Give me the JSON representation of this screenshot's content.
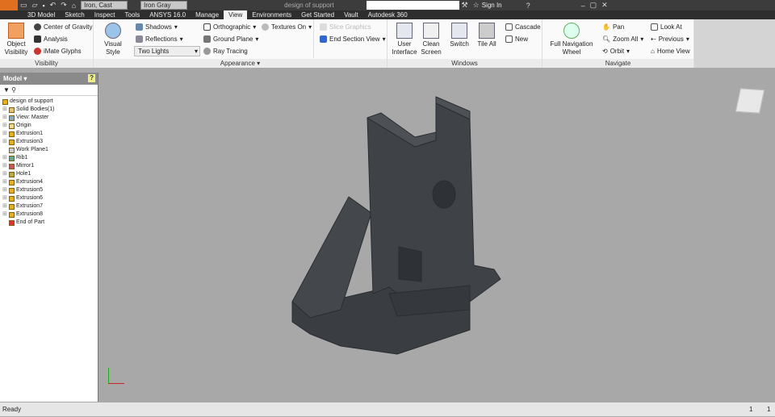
{
  "titlebar": {
    "material": "Iron, Cast",
    "appearance": "Iron Gray",
    "doc_title": "design of support",
    "sign_in": "Sign In"
  },
  "tabs": [
    "3D Model",
    "Sketch",
    "Inspect",
    "Tools",
    "ANSYS 16.0",
    "Manage",
    "View",
    "Environments",
    "Get Started",
    "Vault",
    "Autodesk 360"
  ],
  "ribbon": {
    "visibility": {
      "label": "Visibility",
      "object_visibility": "Object Visibility",
      "center_of_gravity": "Center of Gravity",
      "analysis": "Analysis",
      "imate_glyphs": "iMate Glyphs"
    },
    "appearance": {
      "label": "Appearance",
      "visual_style": "Visual Style",
      "shadows": "Shadows",
      "reflections": "Reflections",
      "lighting": "Two Lights",
      "orthographic": "Orthographic",
      "ground_plane": "Ground Plane",
      "ray_tracing": "Ray Tracing",
      "textures": "Textures On",
      "slice_graphics": "Slice Graphics",
      "end_section_view": "End Section View"
    },
    "windows": {
      "label": "Windows",
      "user_interface": "User Interface",
      "clean_screen": "Clean Screen",
      "switch": "Switch",
      "tile_all": "Tile All",
      "cascade": "Cascade",
      "new": "New"
    },
    "navigate": {
      "label": "Navigate",
      "full_nav_wheel": "Full Navigation Wheel",
      "pan": "Pan",
      "zoom_all": "Zoom All",
      "orbit": "Orbit",
      "look_at": "Look At",
      "previous": "Previous",
      "home_view": "Home View"
    }
  },
  "browser": {
    "title": "Model",
    "root": "design of support",
    "nodes": [
      "Solid Bodies(1)",
      "View: Master",
      "Origin",
      "Extrusion1",
      "Extrusion3",
      "Work Plane1",
      "Rib1",
      "Mirror1",
      "Hole1",
      "Extrusion4",
      "Extrusion5",
      "Extrusion6",
      "Extrusion7",
      "Extrusion8",
      "End of Part"
    ]
  },
  "status": {
    "text": "Ready",
    "count1": "1",
    "count2": "1"
  }
}
